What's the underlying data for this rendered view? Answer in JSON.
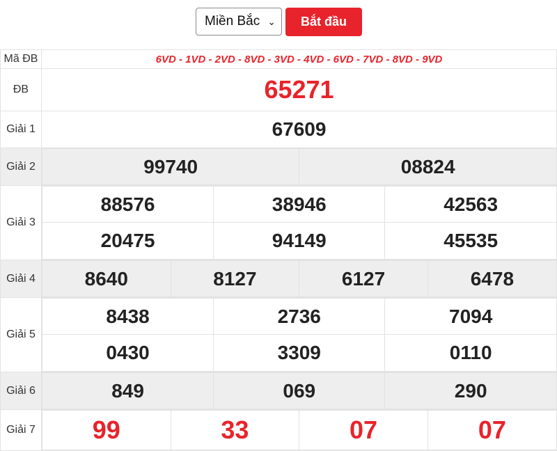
{
  "controls": {
    "region_selected": "Miền Bắc",
    "start_label": "Bắt đầu"
  },
  "labels": {
    "ma_db": "Mã ĐB",
    "db": "ĐB",
    "g1": "Giải 1",
    "g2": "Giải 2",
    "g3": "Giải 3",
    "g4": "Giải 4",
    "g5": "Giải 5",
    "g6": "Giải 6",
    "g7": "Giải 7"
  },
  "results": {
    "ma_db_codes": "6VD - 1VD - 2VD - 8VD - 3VD - 4VD - 6VD - 7VD - 8VD - 9VD",
    "db": "65271",
    "g1": [
      "67609"
    ],
    "g2": [
      "99740",
      "08824"
    ],
    "g3": [
      "88576",
      "38946",
      "42563",
      "20475",
      "94149",
      "45535"
    ],
    "g4": [
      "8640",
      "8127",
      "6127",
      "6478"
    ],
    "g5": [
      "8438",
      "2736",
      "7094",
      "0430",
      "3309",
      "0110"
    ],
    "g6": [
      "849",
      "069",
      "290"
    ],
    "g7": [
      "99",
      "33",
      "07",
      "07"
    ]
  },
  "colors": {
    "accent_red": "#e8232b",
    "row_shade": "#eeeeee",
    "border": "#e2e2e2"
  }
}
